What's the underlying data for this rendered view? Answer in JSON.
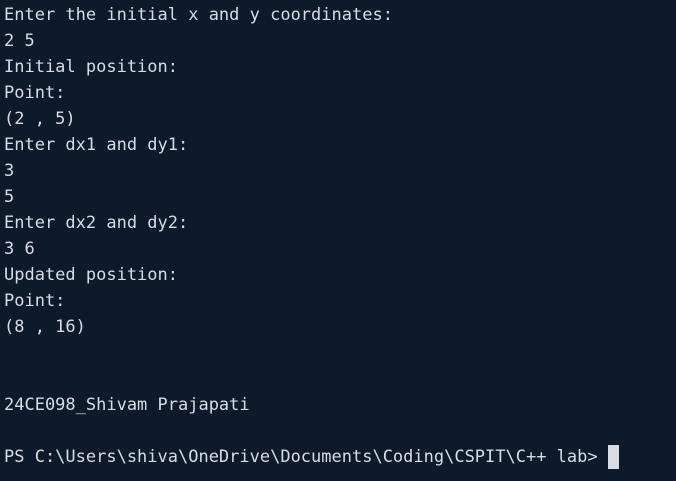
{
  "terminal": {
    "lines": [
      "Enter the initial x and y coordinates:",
      "2 5",
      "Initial position:",
      "Point:",
      "(2 , 5)",
      "Enter dx1 and dy1:",
      "3",
      "5",
      "Enter dx2 and dy2:",
      "3 6",
      "Updated position:",
      "Point:",
      "(8 , 16)",
      "",
      "",
      "24CE098_Shivam Prajapati",
      "",
      ""
    ],
    "prompt": "PS C:\\Users\\shiva\\OneDrive\\Documents\\Coding\\CSPIT\\C++ lab>"
  },
  "colors": {
    "background": "#0c1a2b",
    "foreground": "#d9dde3"
  }
}
